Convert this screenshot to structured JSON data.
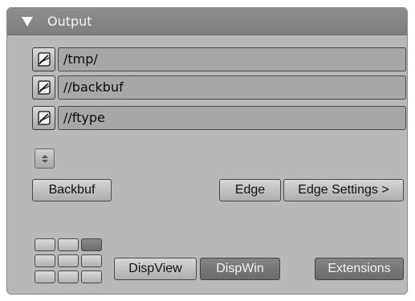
{
  "panel": {
    "title": "Output",
    "collapse_icon": "triangle-down-icon"
  },
  "paths": [
    {
      "value": "/tmp/",
      "icon": "file-browse-icon"
    },
    {
      "value": "//backbuf",
      "icon": "file-browse-icon"
    },
    {
      "value": "//ftype",
      "icon": "file-browse-icon"
    }
  ],
  "spinner": {
    "icon": "up-down-arrows-icon"
  },
  "buttons": {
    "backbuf": "Backbuf",
    "edge": "Edge",
    "edge_settings": "Edge Settings >",
    "dispview": "DispView",
    "dispwin": "DispWin",
    "extensions": "Extensions"
  },
  "layout_grid": {
    "rows": 3,
    "cols": 3,
    "active_cell": "row-1-col-3"
  },
  "colors": {
    "panel_bg": "#b8b8b8",
    "header_bg": "#8d8d8d",
    "active_button": "#7a7a7a",
    "field_bg": "#a7a7a7"
  }
}
